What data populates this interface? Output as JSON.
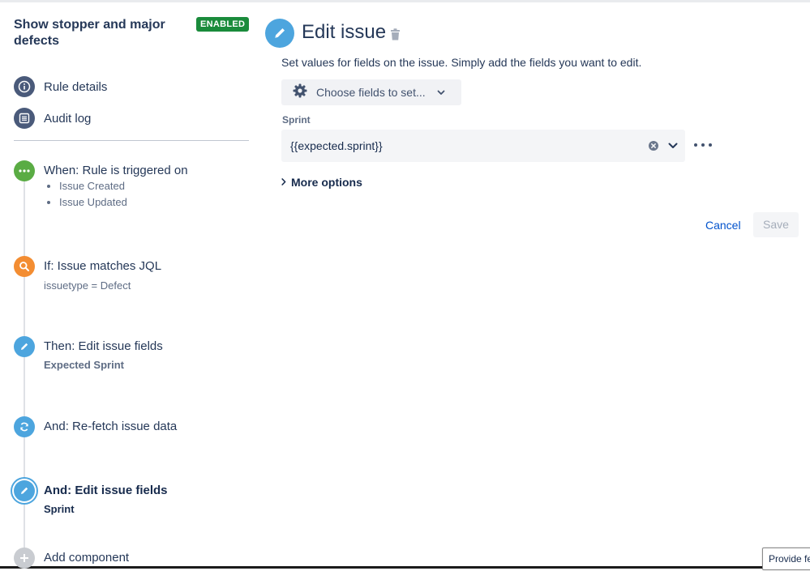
{
  "rule": {
    "title": "Show stopper and major defects",
    "status": "ENABLED"
  },
  "nav": [
    {
      "label": "Rule details",
      "icon": "info-icon"
    },
    {
      "label": "Audit log",
      "icon": "list-icon"
    }
  ],
  "steps": {
    "trigger": {
      "title": "When: Rule is triggered on",
      "items": [
        "Issue Created",
        "Issue Updated"
      ]
    },
    "condition": {
      "title": "If: Issue matches JQL",
      "subtitle": "issuetype = Defect"
    },
    "action1": {
      "title": "Then: Edit issue fields",
      "subtitle": "Expected Sprint"
    },
    "action2": {
      "title": "And: Re-fetch issue data"
    },
    "action3": {
      "title": "And: Edit issue fields",
      "subtitle": "Sprint"
    },
    "add": {
      "title": "Add component"
    }
  },
  "editor": {
    "title": "Edit issue",
    "description": "Set values for fields on the issue. Simply add the fields you want to edit.",
    "choose_fields": "Choose fields to set...",
    "field_label": "Sprint",
    "field_value": "{{expected.sprint}}",
    "more_options": "More options",
    "cancel": "Cancel",
    "save": "Save"
  },
  "feedback": "Provide fe",
  "colors": {
    "enabled_badge": "#1a8b3b",
    "trigger": "#5aac44",
    "condition": "#f38d32",
    "action": "#4da5de",
    "link": "#0052cc"
  }
}
